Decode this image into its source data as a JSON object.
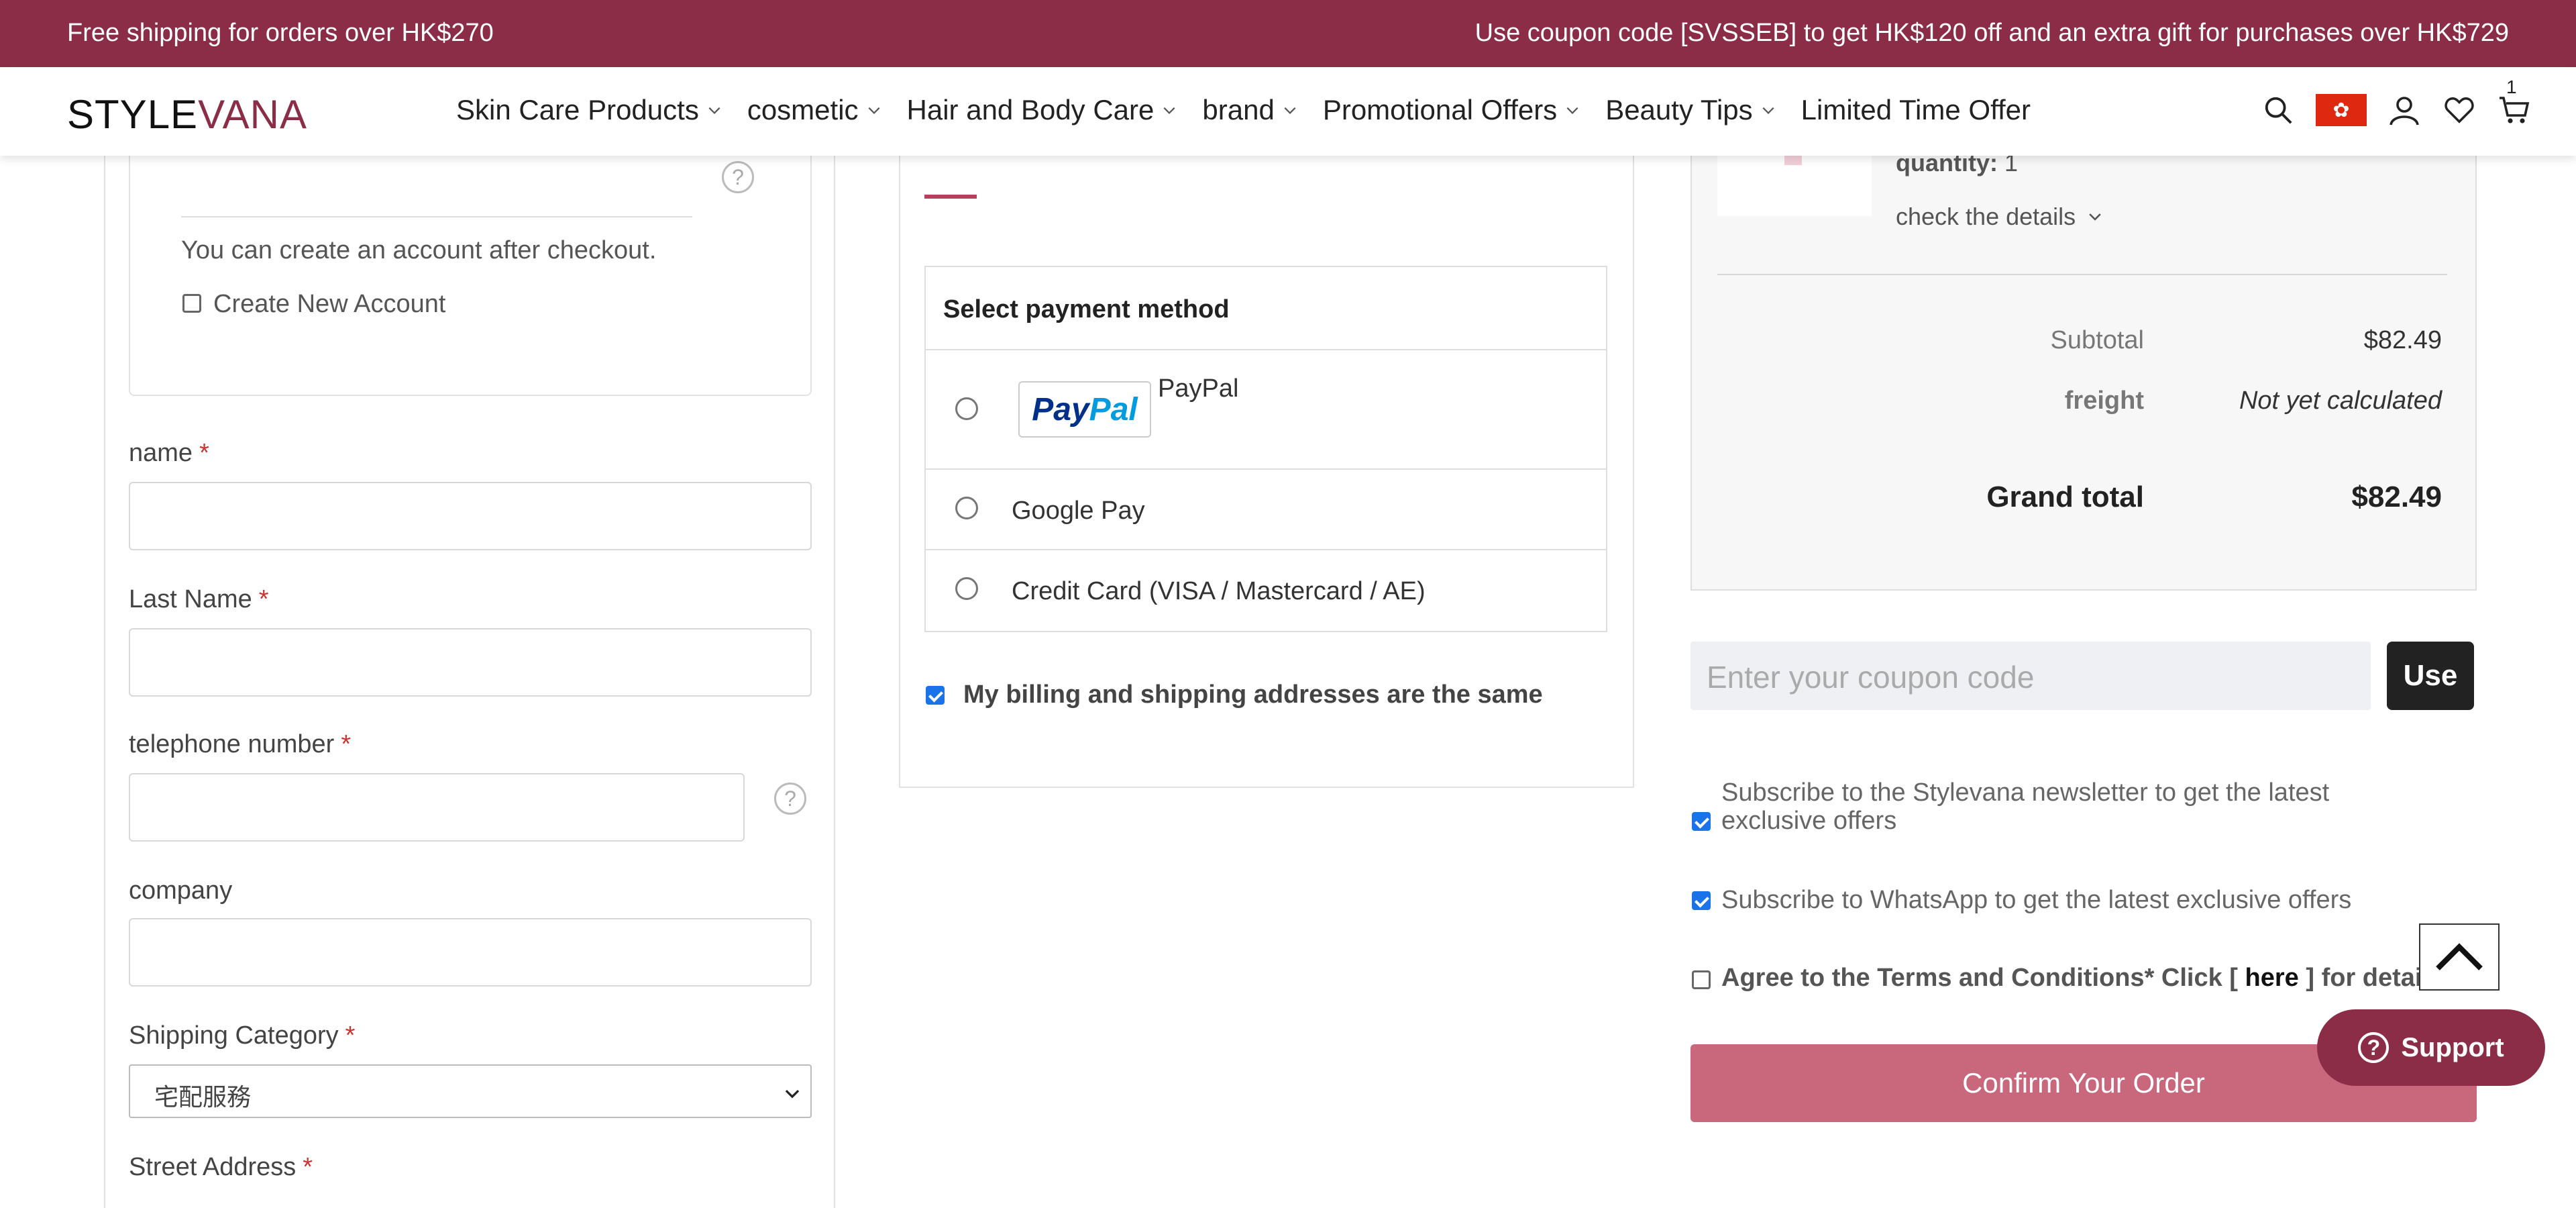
{
  "promo": {
    "left": "Free shipping for orders over HK$270",
    "right": "Use coupon code [SVSSEB] to get HK$120 off and an extra gift for purchases over HK$729"
  },
  "header": {
    "logo_a": "STYLE",
    "logo_b": "VANA",
    "nav": [
      "Skin Care Products",
      "cosmetic",
      "Hair and Body Care",
      "brand",
      "Promotional Offers",
      "Beauty Tips",
      "Limited Time Offer"
    ],
    "cart_count": "1",
    "icons": [
      "search-icon",
      "hk-flag-icon",
      "user-icon",
      "heart-icon",
      "cart-icon"
    ]
  },
  "account": {
    "help": "?",
    "after_checkout": "You can create an account after checkout.",
    "create_account_label": "Create New Account"
  },
  "form": {
    "name_label": "name",
    "last_name_label": "Last Name",
    "telephone_label": "telephone number",
    "company_label": "company",
    "shipping_category_label": "Shipping Category",
    "shipping_category_value": "宅配服務",
    "street_label": "Street Address",
    "required_mark": "*"
  },
  "payment": {
    "heading": "Select payment method",
    "paypal_logo_a": "Pay",
    "paypal_logo_b": "Pal",
    "paypal_label": "PayPal",
    "google_pay_label": "Google Pay",
    "credit_card_label": "Credit Card (VISA / Mastercard / AE)",
    "same_address_label": "My billing and shipping addresses are the same"
  },
  "summary": {
    "quantity_label": "quantity:",
    "quantity_value": "1",
    "details_link": "check the details",
    "subtotal_label": "Subtotal",
    "subtotal_value": "$82.49",
    "freight_label": "freight",
    "freight_value": "Not yet calculated",
    "grand_total_label": "Grand total",
    "grand_total_value": "$82.49"
  },
  "coupon": {
    "placeholder": "Enter your coupon code",
    "button": "Use"
  },
  "subscriptions": {
    "newsletter_line1": "Subscribe to the Stylevana newsletter to get the latest",
    "newsletter_line2": "exclusive offers",
    "whatsapp": "Subscribe to WhatsApp to get the latest exclusive offers",
    "terms_a": "Agree to the Terms and Conditions* Click [",
    "terms_link": "here",
    "terms_b": "] for details."
  },
  "actions": {
    "confirm": "Confirm Your Order",
    "support": "Support"
  },
  "colors": {
    "brand": "#8b2d47",
    "confirm_button": "#c9687d",
    "checkbox_checked": "#1a73e8"
  }
}
